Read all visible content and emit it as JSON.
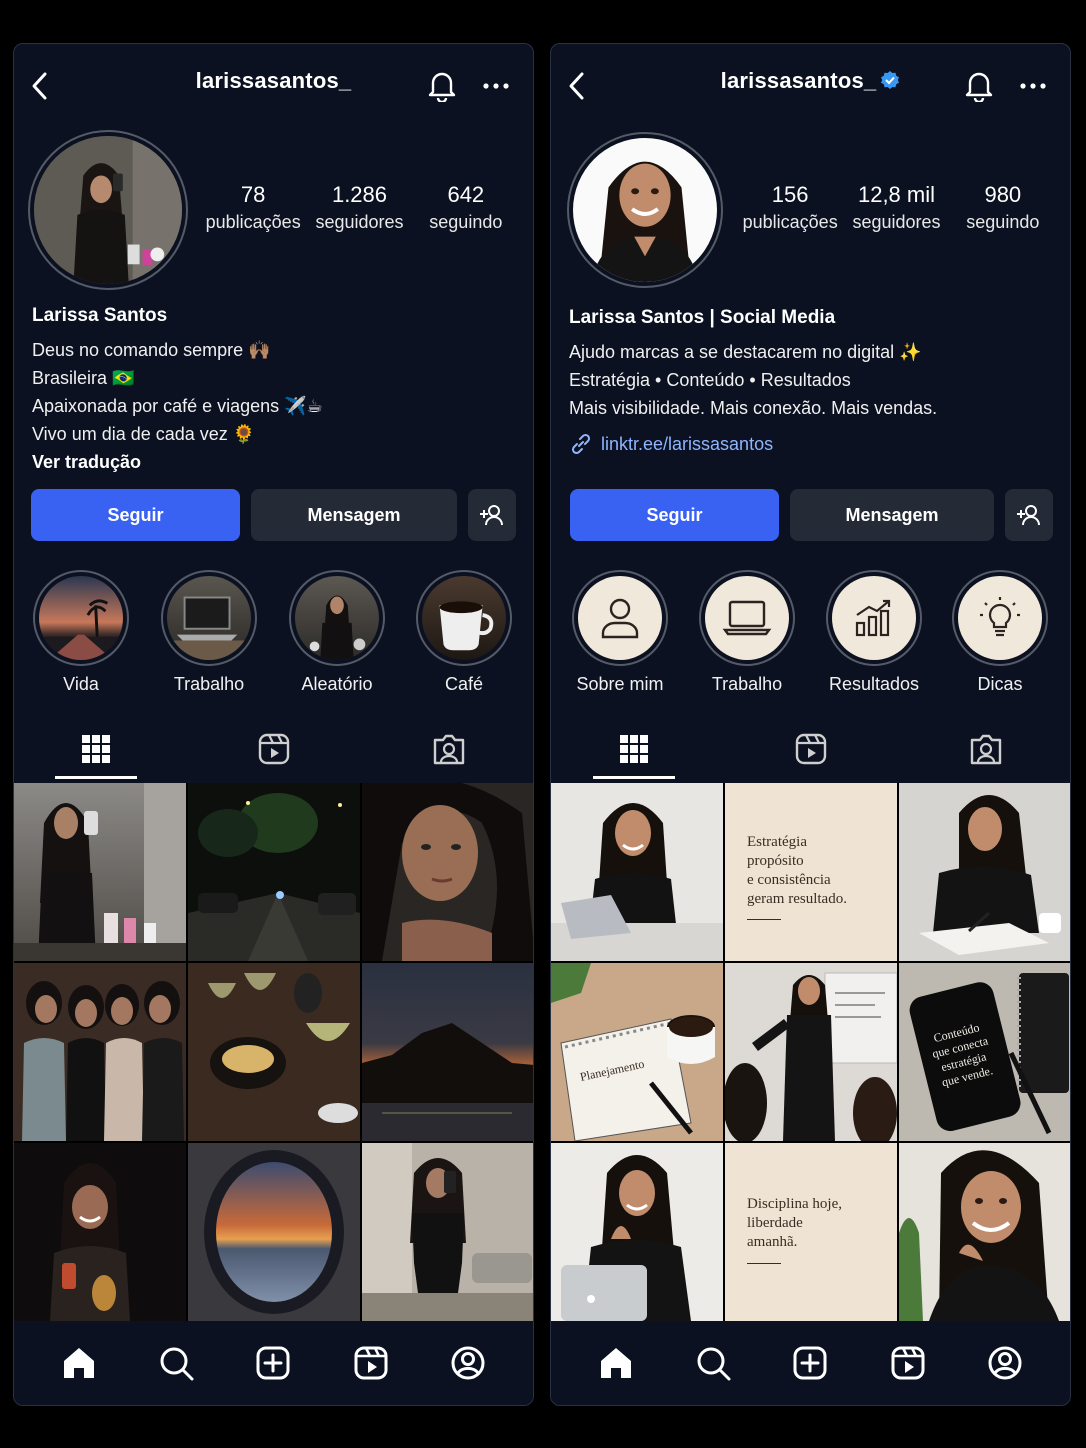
{
  "left": {
    "username": "larissasantos_",
    "stats": [
      {
        "num": "78",
        "label": "publicações"
      },
      {
        "num": "1.286",
        "label": "seguidores"
      },
      {
        "num": "642",
        "label": "seguindo"
      }
    ],
    "name": "Larissa Santos",
    "bio": [
      "Deus no comando sempre 🙌🏽",
      "Brasileira 🇧🇷",
      "Apaixonada por café e viagens ✈️☕",
      "Vivo um dia de cada vez 🌻"
    ],
    "see_translation": "Ver tradução",
    "follow_label": "Seguir",
    "message_label": "Mensagem",
    "highlights": [
      "Vida",
      "Trabalho",
      "Aleatório",
      "Café"
    ]
  },
  "right": {
    "username": "larissasantos_",
    "stats": [
      {
        "num": "156",
        "label": "publicações"
      },
      {
        "num": "12,8 mil",
        "label": "seguidores"
      },
      {
        "num": "980",
        "label": "seguindo"
      }
    ],
    "name": "Larissa Santos | Social Media",
    "bio": [
      "Ajudo marcas a se destacarem no digital ✨",
      "Estratégia • Conteúdo • Resultados",
      "Mais visibilidade. Mais conexão. Mais vendas."
    ],
    "link": "linktr.ee/larissasantos",
    "follow_label": "Seguir",
    "message_label": "Mensagem",
    "highlights": [
      "Sobre mim",
      "Trabalho",
      "Resultados",
      "Dicas"
    ],
    "quote1": [
      "Estratégia",
      "propósito",
      "e consistência",
      "geram resultado."
    ],
    "notebook_label": "Planejamento",
    "phone_quote": [
      "Conteúdo",
      "que conecta",
      "estratégia",
      "que vende."
    ],
    "quote2": [
      "Disciplina hoje,",
      "liberdade",
      "amanhã."
    ]
  },
  "colors": {
    "accent": "#3a62f2",
    "secondary_button": "#242a36",
    "background": "#0b1120",
    "link": "#8fb4ff",
    "verified": "#3897f0"
  },
  "icons": [
    "back-arrow-icon",
    "bell-icon",
    "more-icon",
    "verified-badge-icon",
    "add-person-icon",
    "grid-icon",
    "reels-icon",
    "tagged-icon",
    "home-icon",
    "search-icon",
    "create-icon",
    "profile-icon",
    "link-icon",
    "person-icon",
    "laptop-icon",
    "chart-icon",
    "lightbulb-icon"
  ]
}
